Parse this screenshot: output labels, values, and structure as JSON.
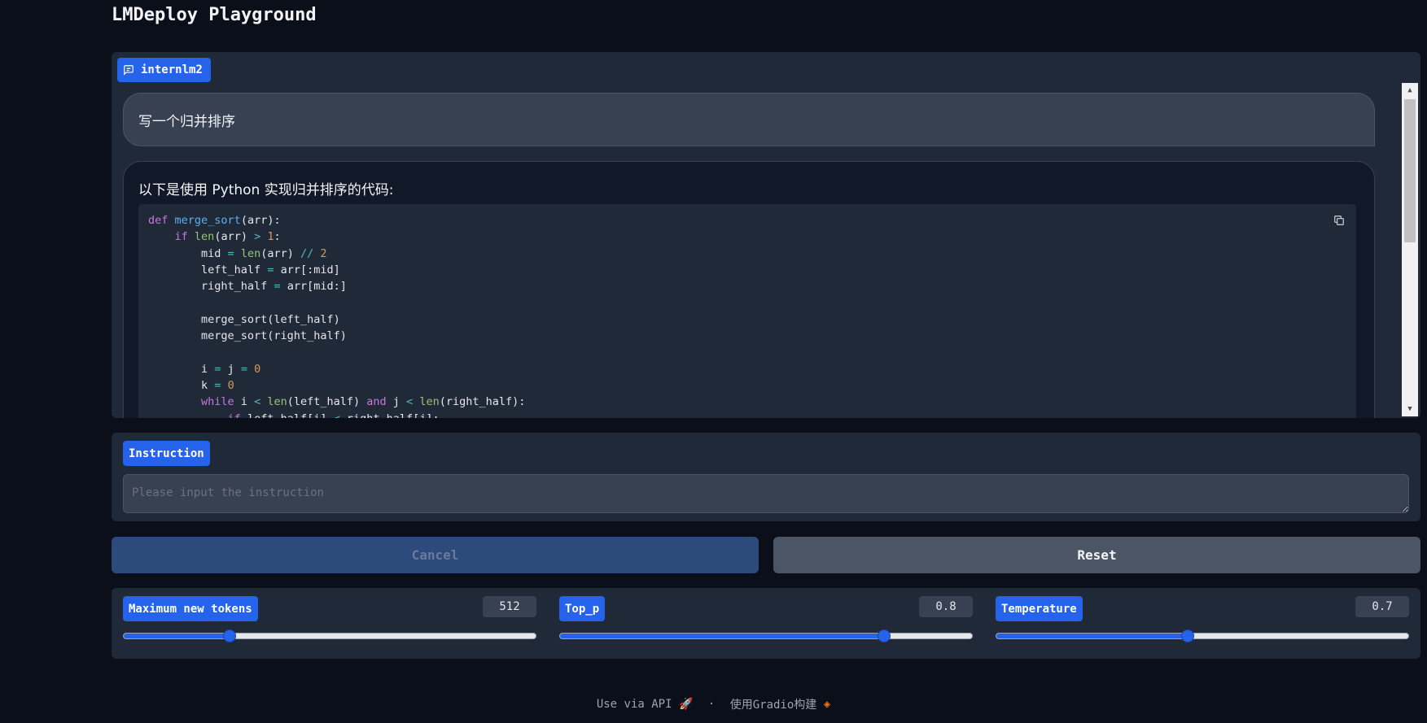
{
  "app": {
    "title": "LMDeploy Playground"
  },
  "chat": {
    "model_label": "internlm2",
    "user_message": "写一个归并排序",
    "bot_intro": "以下是使用 Python 实现归并排序的代码:",
    "code": [
      "def merge_sort(arr):",
      "    if len(arr) > 1:",
      "        mid = len(arr) // 2",
      "        left_half = arr[:mid]",
      "        right_half = arr[mid:]",
      "",
      "        merge_sort(left_half)",
      "        merge_sort(right_half)",
      "",
      "        i = j = 0",
      "        k = 0",
      "        while i < len(left_half) and j < len(right_half):",
      "            if left_half[i] < right_half[j]:"
    ]
  },
  "instruction": {
    "label": "Instruction",
    "placeholder": "Please input the instruction",
    "value": ""
  },
  "buttons": {
    "cancel": "Cancel",
    "reset": "Reset"
  },
  "params": [
    {
      "label": "Maximum new tokens",
      "value": "512",
      "fraction": 0.256
    },
    {
      "label": "Top_p",
      "value": "0.8",
      "fraction": 0.787
    },
    {
      "label": "Temperature",
      "value": "0.7",
      "fraction": 0.465
    }
  ],
  "footer": {
    "api_text": "Use via API",
    "separator": "·",
    "built_with": "使用Gradio构建"
  },
  "colors": {
    "accent": "#2563eb",
    "background": "#0b0f19",
    "panel": "#1f2937"
  }
}
